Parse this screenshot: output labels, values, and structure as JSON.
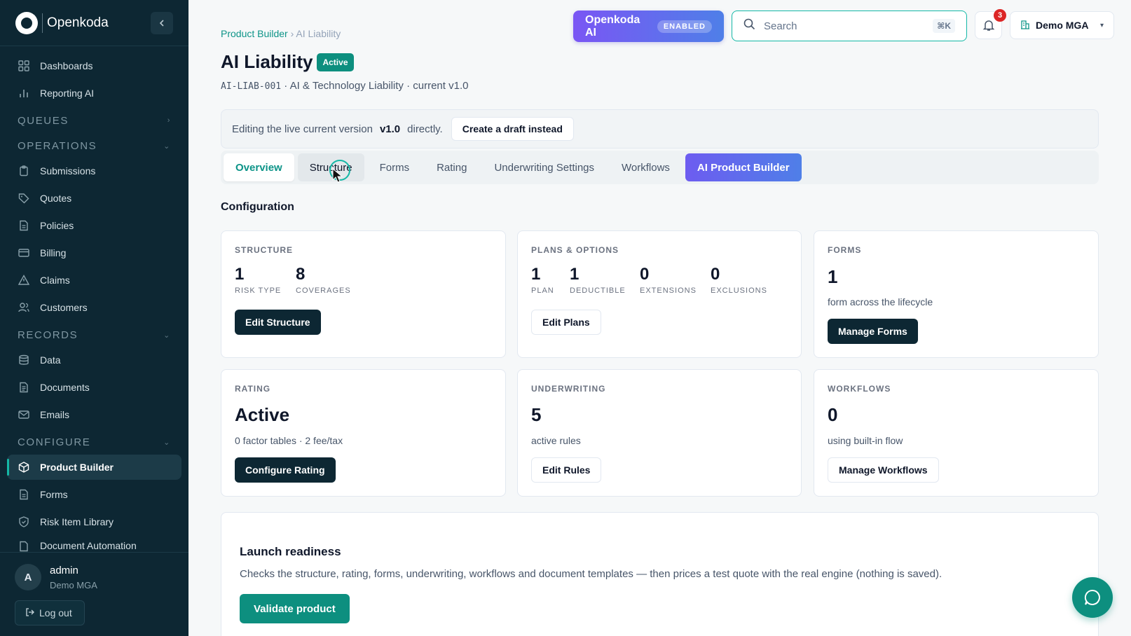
{
  "brand": {
    "name": "Openkoda"
  },
  "sidebar": {
    "items_top": [
      {
        "label": "Dashboards",
        "icon": "grid-icon"
      },
      {
        "label": "Reporting AI",
        "icon": "bar-chart-icon"
      }
    ],
    "queues": {
      "label": "QUEUES"
    },
    "operations": {
      "label": "OPERATIONS",
      "items": [
        {
          "label": "Submissions",
          "icon": "clipboard-icon"
        },
        {
          "label": "Quotes",
          "icon": "tag-icon"
        },
        {
          "label": "Policies",
          "icon": "file-icon"
        },
        {
          "label": "Billing",
          "icon": "card-icon"
        },
        {
          "label": "Claims",
          "icon": "warning-icon"
        },
        {
          "label": "Customers",
          "icon": "users-icon"
        }
      ]
    },
    "records": {
      "label": "RECORDS",
      "items": [
        {
          "label": "Data",
          "icon": "database-icon"
        },
        {
          "label": "Documents",
          "icon": "document-icon"
        },
        {
          "label": "Emails",
          "icon": "mail-icon"
        }
      ]
    },
    "configure": {
      "label": "CONFIGURE",
      "items": [
        {
          "label": "Product Builder",
          "icon": "box-icon"
        },
        {
          "label": "Forms",
          "icon": "form-icon"
        },
        {
          "label": "Risk Item Library",
          "icon": "shield-icon"
        },
        {
          "label": "Document Automation",
          "icon": "doc-auto-icon"
        }
      ]
    },
    "user": {
      "initial": "A",
      "name": "admin",
      "org": "Demo MGA",
      "logout": "Log out"
    }
  },
  "topbar": {
    "ai_label": "Openkoda AI",
    "ai_status": "ENABLED",
    "search_placeholder": "Search",
    "search_shortcut": "⌘K",
    "notifications": "3",
    "org": "Demo MGA"
  },
  "breadcrumb": {
    "parent": "Product Builder",
    "sep": "›",
    "current": "AI Liability"
  },
  "product": {
    "title": "AI Liability",
    "status": "Active",
    "code": "AI-LIAB-001",
    "meta": " · AI & Technology Liability · current v1.0"
  },
  "notice": {
    "text_pre": "Editing the live current version",
    "version": "v1.0",
    "text_post": "directly.",
    "button": "Create a draft instead"
  },
  "tabs": [
    "Overview",
    "Structure",
    "Forms",
    "Rating",
    "Underwriting Settings",
    "Workflows",
    "AI Product Builder"
  ],
  "configuration_title": "Configuration",
  "cards": {
    "structure": {
      "label": "STRUCTURE",
      "stats": [
        {
          "n": "1",
          "l": "RISK TYPE"
        },
        {
          "n": "8",
          "l": "COVERAGES"
        }
      ],
      "button": "Edit Structure"
    },
    "plans": {
      "label": "PLANS & OPTIONS",
      "stats": [
        {
          "n": "1",
          "l": "PLAN"
        },
        {
          "n": "1",
          "l": "DEDUCTIBLE"
        },
        {
          "n": "0",
          "l": "EXTENSIONS"
        },
        {
          "n": "0",
          "l": "EXCLUSIONS"
        }
      ],
      "button": "Edit Plans"
    },
    "forms": {
      "label": "FORMS",
      "value": "1",
      "sub": "form across the lifecycle",
      "button": "Manage Forms"
    },
    "rating": {
      "label": "RATING",
      "value": "Active",
      "sub": "0 factor tables · 2 fee/tax",
      "button": "Configure Rating"
    },
    "underwriting": {
      "label": "UNDERWRITING",
      "value": "5",
      "sub": "active rules",
      "button": "Edit Rules"
    },
    "workflows": {
      "label": "WORKFLOWS",
      "value": "0",
      "sub": "using built-in flow",
      "button": "Manage Workflows"
    }
  },
  "launch": {
    "title": "Launch readiness",
    "text": "Checks the structure, rating, forms, underwriting, workflows and document templates — then prices a test quote with the real engine (nothing is saved).",
    "button": "Validate product"
  },
  "colors": {
    "accent": "#0d8f7f",
    "sidebar": "#0d2733",
    "ai_gradient_start": "#7a56f4",
    "ai_gradient_end": "#4f7fe8"
  }
}
